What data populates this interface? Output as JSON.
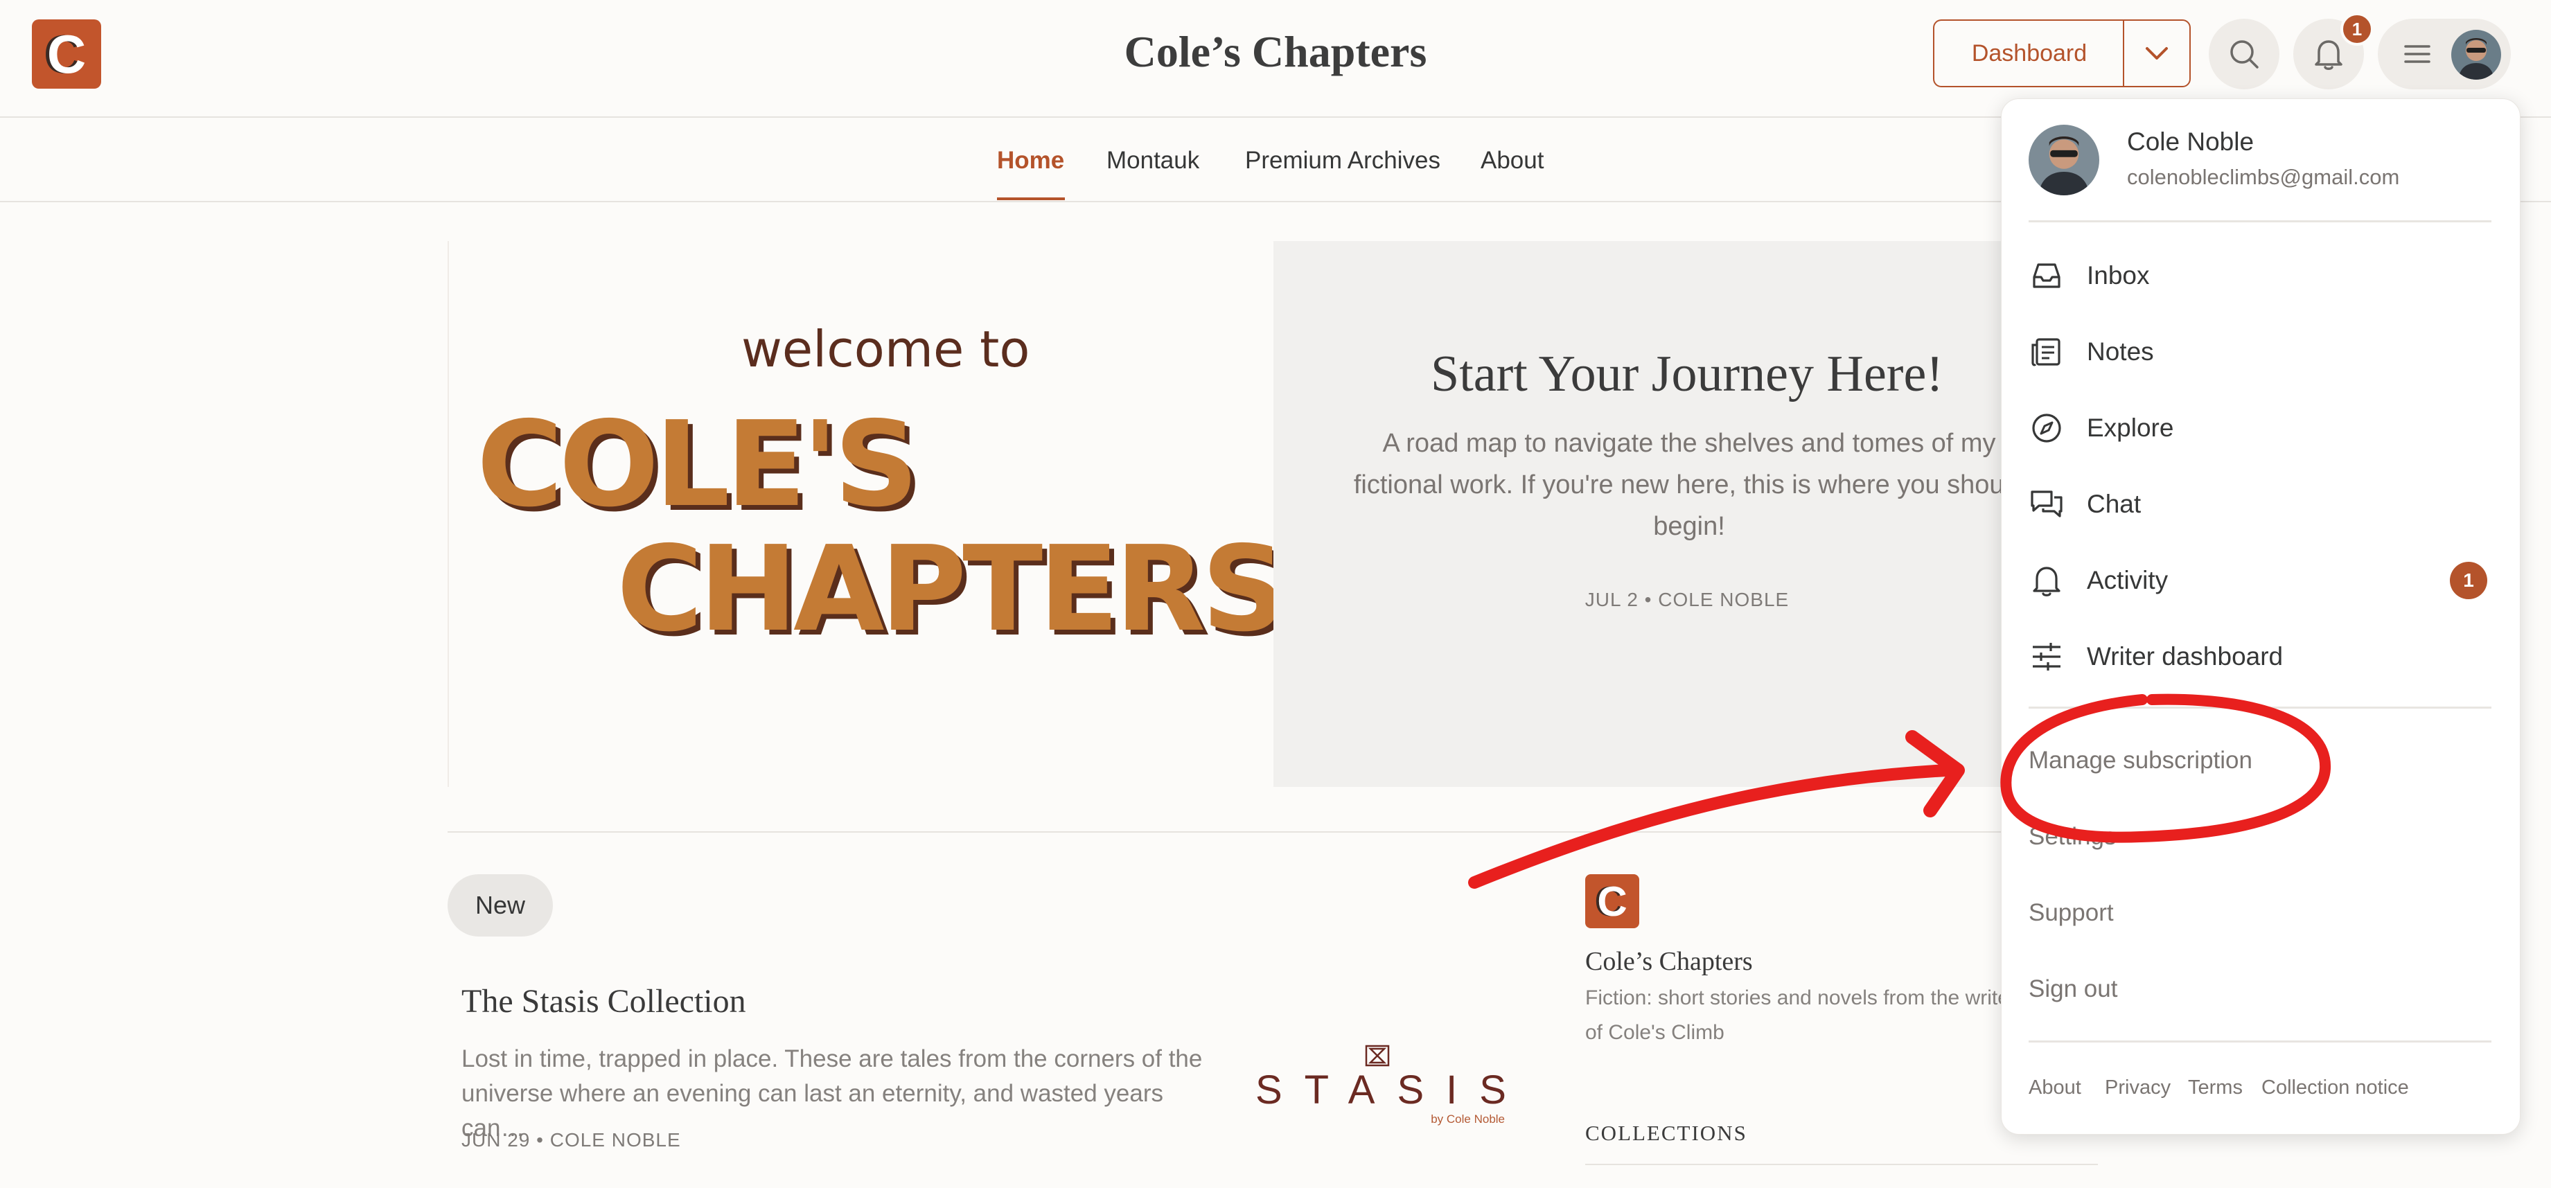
{
  "header": {
    "logo_letter": "C",
    "publication_title": "Cole’s Chapters",
    "dashboard_label": "Dashboard",
    "notification_count": "1"
  },
  "nav": {
    "tabs": [
      "Home",
      "Montauk",
      "Premium Archives",
      "About"
    ],
    "active": "Home"
  },
  "hero": {
    "welcome_to": "welcome to",
    "big_line1": "COLE'S",
    "big_line2": "CHAPTERS"
  },
  "featured": {
    "title": "Start Your Journey Here!",
    "subtitle": "A road map to navigate the shelves and tomes of my fictional work. If you're new here, this is where you should begin!",
    "meta": "JUL 2 • COLE NOBLE"
  },
  "post": {
    "badge": "New",
    "title": "The Stasis Collection",
    "subtitle": "Lost in time, trapped in place. These are tales from the corners of the universe where an evening can last an eternity, and wasted years can…",
    "meta": "JUN 29 • COLE NOBLE",
    "image_word": "STASIS",
    "image_byline": "by Cole Noble"
  },
  "sidebar": {
    "logo_letter": "C",
    "title": "Cole’s Chapters",
    "description": "Fiction: short stories and novels from the writer of Cole's Climb",
    "collections_heading": "COLLECTIONS"
  },
  "user_menu": {
    "name": "Cole Noble",
    "email": "colenobleclimbs@gmail.com",
    "items": [
      {
        "label": "Inbox",
        "icon": "inbox-icon"
      },
      {
        "label": "Notes",
        "icon": "notes-icon"
      },
      {
        "label": "Explore",
        "icon": "compass-icon"
      },
      {
        "label": "Chat",
        "icon": "chat-icon"
      },
      {
        "label": "Activity",
        "icon": "bell-icon",
        "badge": "1"
      },
      {
        "label": "Writer dashboard",
        "icon": "sliders-icon"
      }
    ],
    "secondary": [
      "Manage subscription",
      "Settings",
      "Support",
      "Sign out"
    ],
    "footer": [
      "About",
      "Privacy",
      "Terms",
      "Collection notice"
    ]
  },
  "colors": {
    "accent": "#b4532b",
    "annotation": "#e8201e"
  }
}
